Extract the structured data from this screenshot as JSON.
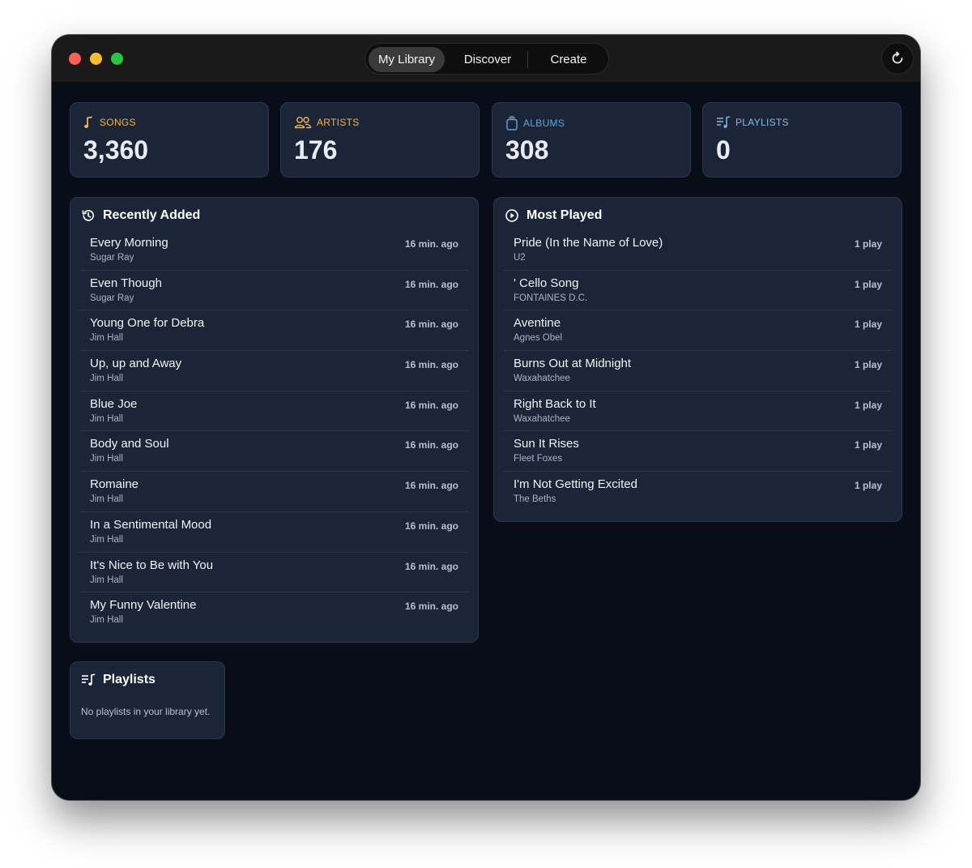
{
  "colors": {
    "songs": "#f0b54a",
    "artists": "#f0b54a",
    "albums": "#5aa8e0",
    "playlists": "#86b7e6"
  },
  "titlebar": {
    "tabs": [
      "My Library",
      "Discover",
      "Create"
    ],
    "active_tab": "My Library",
    "refresh_icon": "refresh-icon"
  },
  "stats": {
    "songs": {
      "label": "SONGS",
      "value": "3,360",
      "icon": "music-note-icon"
    },
    "artists": {
      "label": "ARTISTS",
      "value": "176",
      "icon": "people-icon"
    },
    "albums": {
      "label": "ALBUMS",
      "value": "308",
      "icon": "album-stack-icon"
    },
    "playlists": {
      "label": "PLAYLISTS",
      "value": "0",
      "icon": "playlist-icon"
    }
  },
  "recently_added": {
    "title": "Recently Added",
    "icon": "history-icon",
    "items": [
      {
        "title": "Every Morning",
        "artist": "Sugar Ray",
        "meta": "16 min. ago"
      },
      {
        "title": "Even Though",
        "artist": "Sugar Ray",
        "meta": "16 min. ago"
      },
      {
        "title": "Young One for Debra",
        "artist": "Jim Hall",
        "meta": "16 min. ago"
      },
      {
        "title": "Up, up and Away",
        "artist": "Jim Hall",
        "meta": "16 min. ago"
      },
      {
        "title": "Blue Joe",
        "artist": "Jim Hall",
        "meta": "16 min. ago"
      },
      {
        "title": "Body and Soul",
        "artist": "Jim Hall",
        "meta": "16 min. ago"
      },
      {
        "title": "Romaine",
        "artist": "Jim Hall",
        "meta": "16 min. ago"
      },
      {
        "title": "In a Sentimental Mood",
        "artist": "Jim Hall",
        "meta": "16 min. ago"
      },
      {
        "title": "It's Nice to Be with You",
        "artist": "Jim Hall",
        "meta": "16 min. ago"
      },
      {
        "title": "My Funny Valentine",
        "artist": "Jim Hall",
        "meta": "16 min. ago"
      }
    ]
  },
  "most_played": {
    "title": "Most Played",
    "icon": "play-circle-icon",
    "items": [
      {
        "title": "Pride (In the Name of Love)",
        "artist": "U2",
        "meta": "1 play"
      },
      {
        "title": "' Cello Song",
        "artist": "FONTAINES D.C.",
        "meta": "1 play"
      },
      {
        "title": "Aventine",
        "artist": "Agnes Obel",
        "meta": "1 play"
      },
      {
        "title": "Burns Out at Midnight",
        "artist": "Waxahatchee",
        "meta": "1 play"
      },
      {
        "title": "Right Back to It",
        "artist": "Waxahatchee",
        "meta": "1 play"
      },
      {
        "title": "Sun It Rises",
        "artist": "Fleet Foxes",
        "meta": "1 play"
      },
      {
        "title": "I'm Not Getting Excited",
        "artist": "The Beths",
        "meta": "1 play"
      }
    ]
  },
  "playlists_panel": {
    "title": "Playlists",
    "icon": "playlist-icon",
    "empty_text": "No playlists in your library yet."
  }
}
